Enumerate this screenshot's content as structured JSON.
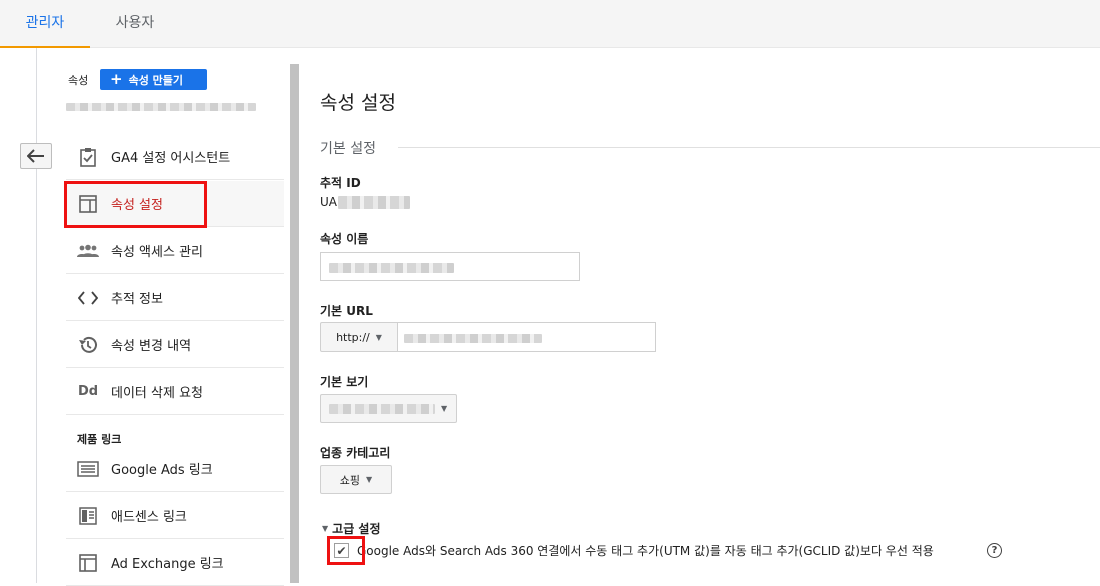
{
  "tabs": [
    {
      "label": "관리자",
      "active": true
    },
    {
      "label": "사용자",
      "active": false
    }
  ],
  "property_header": {
    "label": "속성",
    "create_button": "속성 만들기",
    "create_icon": "plus-icon"
  },
  "nav": {
    "items": [
      {
        "label": "GA4 설정 어시스턴트",
        "icon": "clipboard-check-icon"
      },
      {
        "label": "속성 설정",
        "icon": "layout-icon",
        "selected": true
      },
      {
        "label": "속성 액세스 관리",
        "icon": "people-icon"
      },
      {
        "label": "추적 정보",
        "icon": "code-icon"
      },
      {
        "label": "속성 변경 내역",
        "icon": "history-icon"
      },
      {
        "label": "데이터 삭제 요청",
        "icon": "dd-icon"
      }
    ],
    "section_label": "제품 링크",
    "links": [
      {
        "label": "Google Ads 링크",
        "icon": "ads-icon"
      },
      {
        "label": "애드센스 링크",
        "icon": "adsense-icon"
      },
      {
        "label": "Ad Exchange 링크",
        "icon": "adx-icon"
      }
    ]
  },
  "main": {
    "title": "속성 설정",
    "section": "기본 설정",
    "tracking_id_label": "추적 ID",
    "tracking_id_value": "UA",
    "property_name_label": "속성 이름",
    "base_url_label": "기본 URL",
    "protocol": "http://",
    "default_view_label": "기본 보기",
    "industry_label": "업종 카테고리",
    "industry_value": "쇼핑",
    "advanced_label": "고급 설정",
    "auto_tag_label": "Google Ads와 Search Ads 360 연결에서 수동 태그 추가(UTM 값)를 자동 태그 추가(GCLID 값)보다 우선 적용",
    "help": "?"
  },
  "colors": {
    "accent": "#1a73e8",
    "tab_underline": "#f29900",
    "highlight": "#ee1111",
    "selected_text": "#c5221f"
  }
}
